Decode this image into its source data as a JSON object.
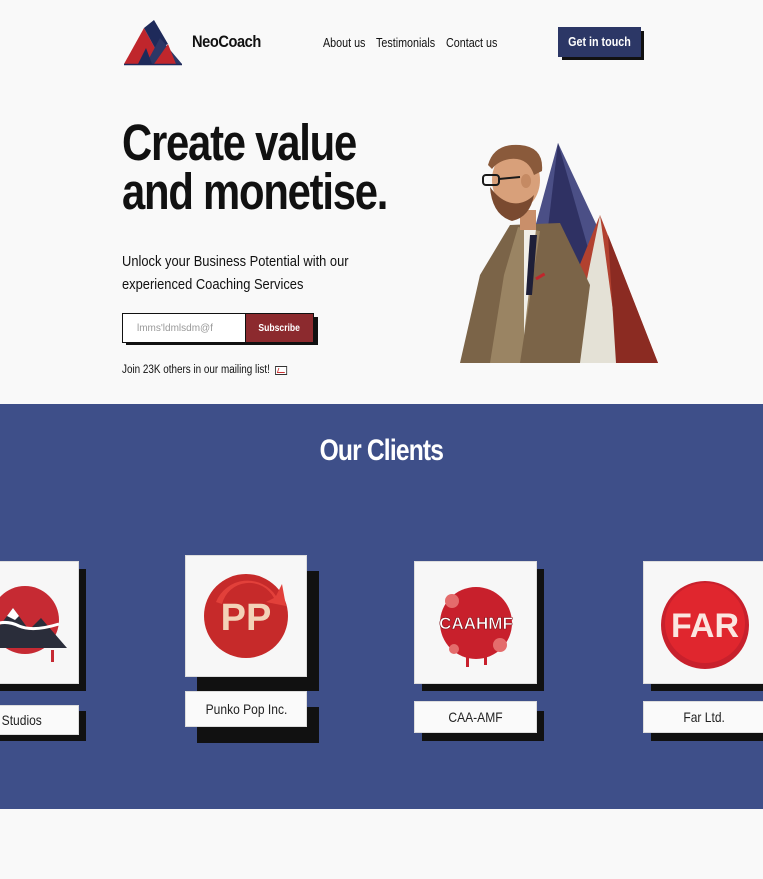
{
  "header": {
    "brand": "NeoCoach",
    "nav": [
      "About us",
      "Testimonials",
      "Contact us"
    ],
    "cta": "Get in touch"
  },
  "hero": {
    "headline_line1": "Create value",
    "headline_line2": "and monetise.",
    "subtitle": "Unlock your Business Potential with our experienced Coaching Services",
    "email_value": "lmms'ldmlsdm@f",
    "subscribe": "Subscribe",
    "join_text": "Join 23K others in our mailing list!"
  },
  "clients": {
    "title": "Our Clients",
    "items": [
      {
        "name": "ji Studios",
        "logo_text": ""
      },
      {
        "name": "Punko Pop Inc.",
        "logo_text": "PP"
      },
      {
        "name": "CAA-AMF",
        "logo_text": "CAAHMF"
      },
      {
        "name": "Far Ltd.",
        "logo_text": "FAR"
      }
    ]
  },
  "colors": {
    "navy": "#2c3766",
    "clients_bg": "#3e4f89",
    "accent_red": "#8c2a2e",
    "page_bg": "#f9f9f9"
  }
}
